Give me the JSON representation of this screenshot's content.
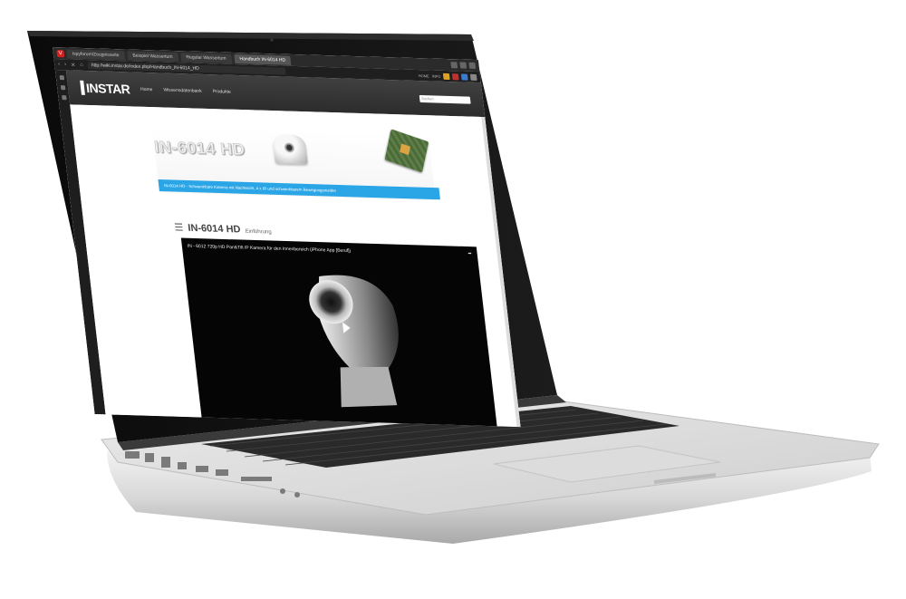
{
  "browser": {
    "tabs": [
      {
        "label": "Ispyforum/Zeugnisseite",
        "active": false
      },
      {
        "label": "Beispiel Wassertum",
        "active": false
      },
      {
        "label": "Regular Wassertum",
        "active": false
      },
      {
        "label": "Handbuch IN-6014 HD",
        "active": true
      }
    ],
    "url": "http://wiki.instar.de/index.php/Handbuch_IN-6014_HD",
    "toolbar_right": [
      "HOME",
      "INFO"
    ]
  },
  "site": {
    "logo": "INSTAR",
    "nav": [
      "Home",
      "Wissensdatenbank",
      "Produkte"
    ],
    "search_placeholder": "Suchen",
    "banner_title": "IN-6014 HD",
    "banner_caption": "IN-6014 HD - Schwenkbare Kamera mit Nachtsicht, 4 x IR und schwenkbarem Bewegungsmelder",
    "heading_title": "IN-6014 HD",
    "heading_sub": "Einführung",
    "video_title": "IN - 6012 720p HD Pan&Tilt IP Kamera für den Innenbereich (iPhone App [Beruf])"
  }
}
